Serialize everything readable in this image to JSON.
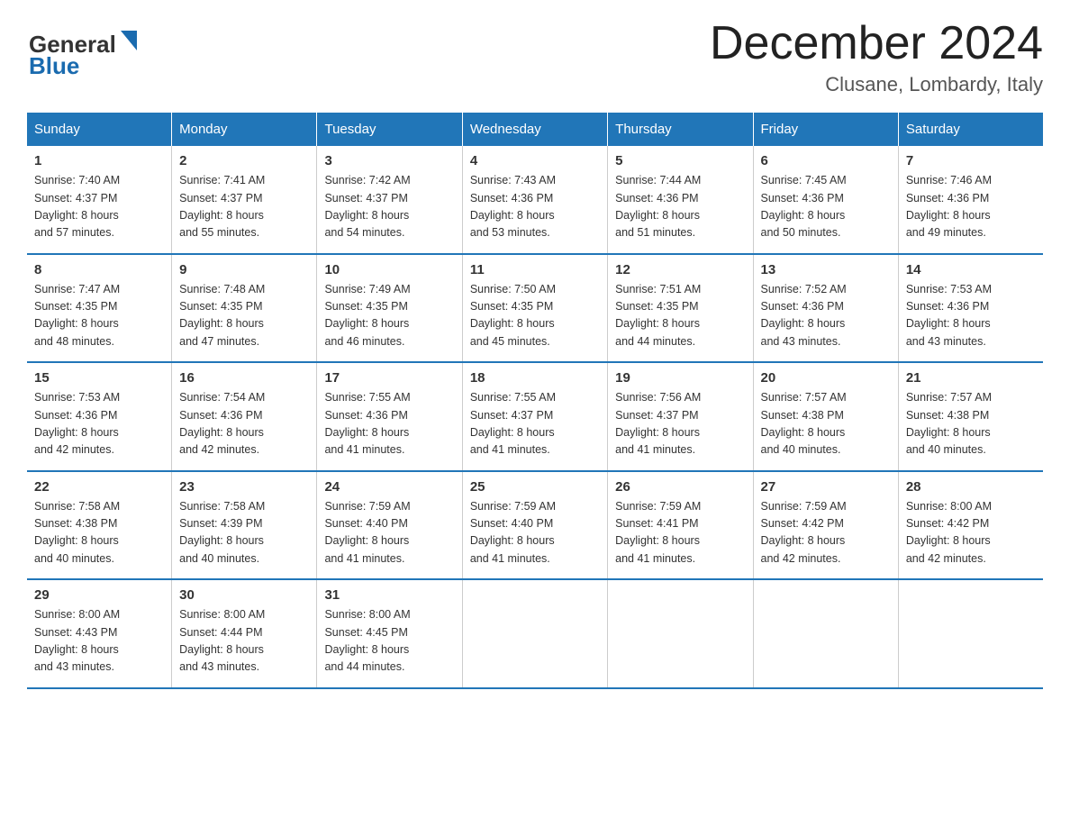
{
  "header": {
    "logo_general": "General",
    "logo_blue": "Blue",
    "title": "December 2024",
    "subtitle": "Clusane, Lombardy, Italy"
  },
  "days_of_week": [
    "Sunday",
    "Monday",
    "Tuesday",
    "Wednesday",
    "Thursday",
    "Friday",
    "Saturday"
  ],
  "weeks": [
    [
      {
        "day": "1",
        "sunrise": "7:40 AM",
        "sunset": "4:37 PM",
        "daylight": "8 hours and 57 minutes."
      },
      {
        "day": "2",
        "sunrise": "7:41 AM",
        "sunset": "4:37 PM",
        "daylight": "8 hours and 55 minutes."
      },
      {
        "day": "3",
        "sunrise": "7:42 AM",
        "sunset": "4:37 PM",
        "daylight": "8 hours and 54 minutes."
      },
      {
        "day": "4",
        "sunrise": "7:43 AM",
        "sunset": "4:36 PM",
        "daylight": "8 hours and 53 minutes."
      },
      {
        "day": "5",
        "sunrise": "7:44 AM",
        "sunset": "4:36 PM",
        "daylight": "8 hours and 51 minutes."
      },
      {
        "day": "6",
        "sunrise": "7:45 AM",
        "sunset": "4:36 PM",
        "daylight": "8 hours and 50 minutes."
      },
      {
        "day": "7",
        "sunrise": "7:46 AM",
        "sunset": "4:36 PM",
        "daylight": "8 hours and 49 minutes."
      }
    ],
    [
      {
        "day": "8",
        "sunrise": "7:47 AM",
        "sunset": "4:35 PM",
        "daylight": "8 hours and 48 minutes."
      },
      {
        "day": "9",
        "sunrise": "7:48 AM",
        "sunset": "4:35 PM",
        "daylight": "8 hours and 47 minutes."
      },
      {
        "day": "10",
        "sunrise": "7:49 AM",
        "sunset": "4:35 PM",
        "daylight": "8 hours and 46 minutes."
      },
      {
        "day": "11",
        "sunrise": "7:50 AM",
        "sunset": "4:35 PM",
        "daylight": "8 hours and 45 minutes."
      },
      {
        "day": "12",
        "sunrise": "7:51 AM",
        "sunset": "4:35 PM",
        "daylight": "8 hours and 44 minutes."
      },
      {
        "day": "13",
        "sunrise": "7:52 AM",
        "sunset": "4:36 PM",
        "daylight": "8 hours and 43 minutes."
      },
      {
        "day": "14",
        "sunrise": "7:53 AM",
        "sunset": "4:36 PM",
        "daylight": "8 hours and 43 minutes."
      }
    ],
    [
      {
        "day": "15",
        "sunrise": "7:53 AM",
        "sunset": "4:36 PM",
        "daylight": "8 hours and 42 minutes."
      },
      {
        "day": "16",
        "sunrise": "7:54 AM",
        "sunset": "4:36 PM",
        "daylight": "8 hours and 42 minutes."
      },
      {
        "day": "17",
        "sunrise": "7:55 AM",
        "sunset": "4:36 PM",
        "daylight": "8 hours and 41 minutes."
      },
      {
        "day": "18",
        "sunrise": "7:55 AM",
        "sunset": "4:37 PM",
        "daylight": "8 hours and 41 minutes."
      },
      {
        "day": "19",
        "sunrise": "7:56 AM",
        "sunset": "4:37 PM",
        "daylight": "8 hours and 41 minutes."
      },
      {
        "day": "20",
        "sunrise": "7:57 AM",
        "sunset": "4:38 PM",
        "daylight": "8 hours and 40 minutes."
      },
      {
        "day": "21",
        "sunrise": "7:57 AM",
        "sunset": "4:38 PM",
        "daylight": "8 hours and 40 minutes."
      }
    ],
    [
      {
        "day": "22",
        "sunrise": "7:58 AM",
        "sunset": "4:38 PM",
        "daylight": "8 hours and 40 minutes."
      },
      {
        "day": "23",
        "sunrise": "7:58 AM",
        "sunset": "4:39 PM",
        "daylight": "8 hours and 40 minutes."
      },
      {
        "day": "24",
        "sunrise": "7:59 AM",
        "sunset": "4:40 PM",
        "daylight": "8 hours and 41 minutes."
      },
      {
        "day": "25",
        "sunrise": "7:59 AM",
        "sunset": "4:40 PM",
        "daylight": "8 hours and 41 minutes."
      },
      {
        "day": "26",
        "sunrise": "7:59 AM",
        "sunset": "4:41 PM",
        "daylight": "8 hours and 41 minutes."
      },
      {
        "day": "27",
        "sunrise": "7:59 AM",
        "sunset": "4:42 PM",
        "daylight": "8 hours and 42 minutes."
      },
      {
        "day": "28",
        "sunrise": "8:00 AM",
        "sunset": "4:42 PM",
        "daylight": "8 hours and 42 minutes."
      }
    ],
    [
      {
        "day": "29",
        "sunrise": "8:00 AM",
        "sunset": "4:43 PM",
        "daylight": "8 hours and 43 minutes."
      },
      {
        "day": "30",
        "sunrise": "8:00 AM",
        "sunset": "4:44 PM",
        "daylight": "8 hours and 43 minutes."
      },
      {
        "day": "31",
        "sunrise": "8:00 AM",
        "sunset": "4:45 PM",
        "daylight": "8 hours and 44 minutes."
      },
      null,
      null,
      null,
      null
    ]
  ],
  "labels": {
    "sunrise": "Sunrise:",
    "sunset": "Sunset:",
    "daylight": "Daylight:"
  }
}
